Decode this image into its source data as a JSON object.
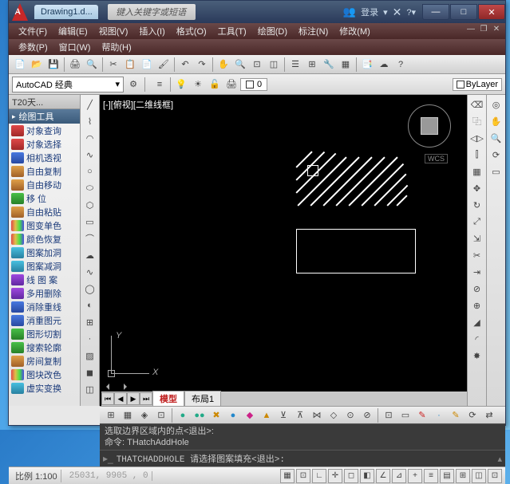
{
  "titlebar": {
    "doc_tab": "Drawing1.d...",
    "search_placeholder": "键入关键字或短语",
    "login": "登录"
  },
  "menu": {
    "items": [
      "文件(F)",
      "编辑(E)",
      "视图(V)",
      "插入(I)",
      "格式(O)",
      "工具(T)",
      "绘图(D)",
      "标注(N)",
      "修改(M)"
    ]
  },
  "menu2": {
    "items": [
      "参数(P)",
      "窗口(W)",
      "帮助(H)"
    ]
  },
  "workspace": {
    "label": "AutoCAD 经典"
  },
  "layer": {
    "current": "0",
    "bylayer": "ByLayer"
  },
  "left_panel": {
    "title": "T20天...",
    "header": "绘图工具",
    "items": [
      {
        "label": "对象查询",
        "ic": "ic-red"
      },
      {
        "label": "对象选择",
        "ic": "ic-red"
      },
      {
        "label": "相机透视",
        "ic": "ic-blue"
      },
      {
        "label": "自由复制",
        "ic": "ic-orange"
      },
      {
        "label": "自由移动",
        "ic": "ic-orange"
      },
      {
        "label": "移  位",
        "ic": "ic-green"
      },
      {
        "label": "自由粘贴",
        "ic": "ic-orange"
      },
      {
        "label": "图变单色",
        "ic": "ic-rainbow"
      },
      {
        "label": "颜色恢复",
        "ic": "ic-rainbow"
      },
      {
        "label": "图案加洞",
        "ic": "ic-cyan"
      },
      {
        "label": "图案减洞",
        "ic": "ic-cyan"
      },
      {
        "label": "线 图 案",
        "ic": "ic-purple"
      },
      {
        "label": "多用删除",
        "ic": "ic-purple"
      },
      {
        "label": "消除重线",
        "ic": "ic-blue"
      },
      {
        "label": "消重图元",
        "ic": "ic-blue"
      },
      {
        "label": "图形切割",
        "ic": "ic-green"
      },
      {
        "label": "搜索轮廓",
        "ic": "ic-green"
      },
      {
        "label": "房间复制",
        "ic": "ic-orange"
      },
      {
        "label": "图块改色",
        "ic": "ic-rainbow"
      },
      {
        "label": "虚实变换",
        "ic": "ic-cyan"
      }
    ]
  },
  "canvas": {
    "label": "[-][俯视][二维线框]",
    "wcs": "WCS",
    "ucs_x": "X",
    "ucs_y": "Y"
  },
  "model_tabs": {
    "model": "模型",
    "layout1": "布局1"
  },
  "cmd": {
    "line1": "选取边界区域内的点<退出>:",
    "line2": "命令: THatchAddHole",
    "prompt": "THATCHADDHOLE 请选择图案填充<退出>:"
  },
  "status": {
    "scale": "比例 1:100",
    "coords": "25031, 9905 , 0"
  }
}
